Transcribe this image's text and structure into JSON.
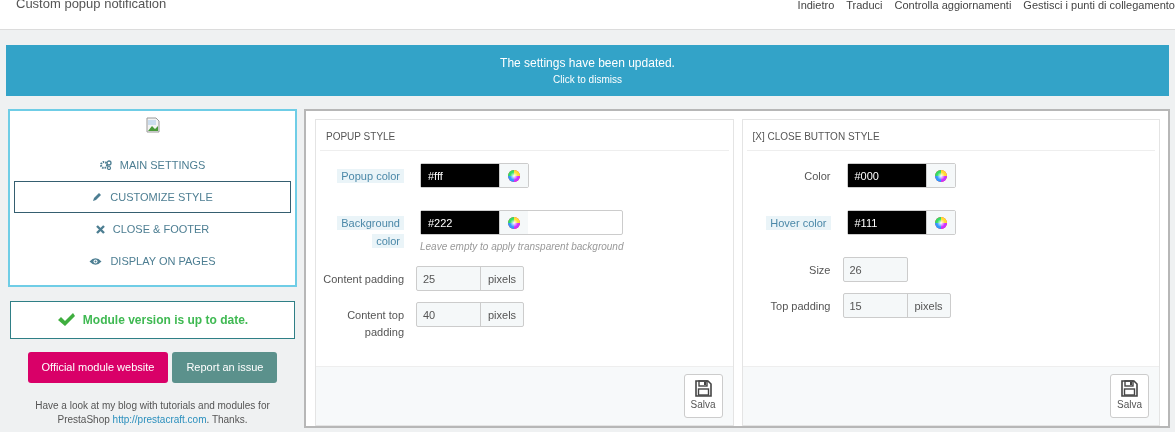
{
  "header": {
    "title": "Custom popup notification",
    "toolbar": [
      "Indietro",
      "Traduci",
      "Controlla aggiornamenti",
      "Gestisci i punti di collegamento"
    ]
  },
  "alert": {
    "message": "The settings have been updated.",
    "dismiss": "Click to dismiss"
  },
  "menu": [
    {
      "label": "MAIN SETTINGS",
      "selected": false
    },
    {
      "label": "CUSTOMIZE STYLE",
      "selected": true
    },
    {
      "label": "CLOSE & FOOTER",
      "selected": false
    },
    {
      "label": "DISPLAY ON PAGES",
      "selected": false
    }
  ],
  "version_status": {
    "text": "Module version is up to date.",
    "ok": true
  },
  "buttons": [
    {
      "label": "Official module website",
      "kind": "primary"
    },
    {
      "label": "Report an issue",
      "kind": "secondary"
    }
  ],
  "blurb": {
    "before": "Have a look at my blog with tutorials and modules for PrestaShop ",
    "link": "http://prestacraft.com",
    "after": ". Thanks."
  },
  "panels": [
    {
      "title": "POPUP STYLE",
      "save": "Salva",
      "fields": [
        {
          "label": "Popup color",
          "hint": true,
          "kind": "color",
          "value": "#fff"
        },
        {
          "label": "Background color",
          "hint": true,
          "kind": "color",
          "value": "#222",
          "help": "Leave empty to apply transparent background"
        },
        {
          "label": "Content padding",
          "hint": false,
          "kind": "number",
          "value": "25",
          "unit": "pixels"
        },
        {
          "label": "Content top padding",
          "hint": false,
          "kind": "number",
          "value": "40",
          "unit": "pixels"
        }
      ]
    },
    {
      "title": "[X] CLOSE BUTTON STYLE",
      "save": "Salva",
      "fields": [
        {
          "label": "Color",
          "hint": false,
          "kind": "color",
          "value": "#000"
        },
        {
          "label": "Hover color",
          "hint": true,
          "kind": "color",
          "value": "#111"
        },
        {
          "label": "Size",
          "hint": false,
          "kind": "number",
          "value": "26"
        },
        {
          "label": "Top padding",
          "hint": false,
          "kind": "number",
          "value": "15",
          "unit": "pixels"
        }
      ]
    }
  ]
}
